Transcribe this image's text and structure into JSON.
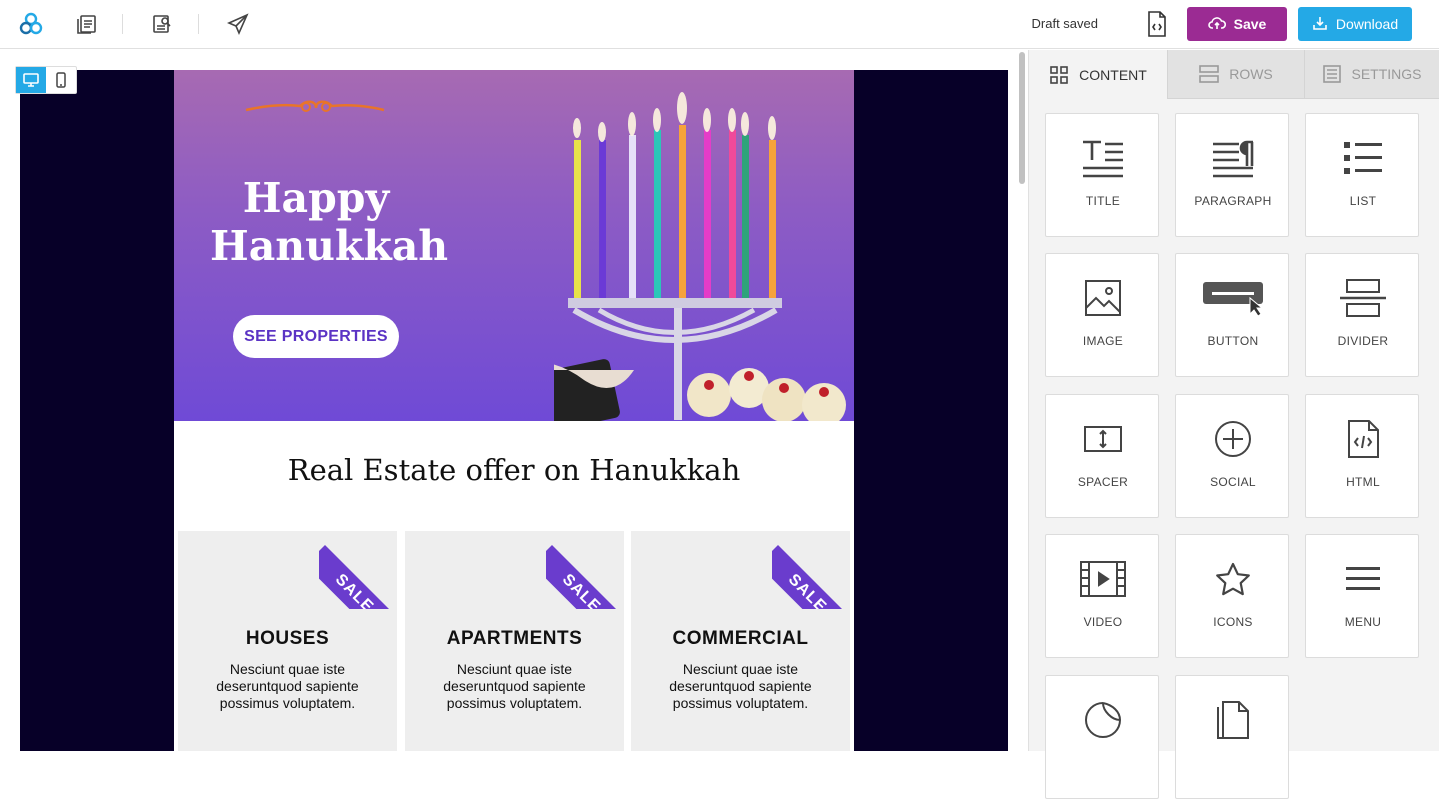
{
  "topbar": {
    "draft_status": "Draft saved",
    "save_label": "Save",
    "download_label": "Download"
  },
  "colors": {
    "save": "#9b2b93",
    "download": "#24a9e6",
    "stage_bg": "#070028",
    "accent_purple": "#6a3ccd"
  },
  "email": {
    "hero_title_line1": "Happy",
    "hero_title_line2": "Hanukkah",
    "hero_button": "SEE PROPERTIES",
    "heading": "Real Estate offer on Hanukkah",
    "cards": [
      {
        "badge": "SALE",
        "title": "HOUSES",
        "text": "Nesciunt quae iste deseruntquod sapiente possimus voluptatem."
      },
      {
        "badge": "SALE",
        "title": "APARTMENTS",
        "text": "Nesciunt quae iste deseruntquod sapiente possimus voluptatem."
      },
      {
        "badge": "SALE",
        "title": "COMMERCIAL",
        "text": "Nesciunt quae iste deseruntquod sapiente possimus voluptatem."
      }
    ]
  },
  "panel": {
    "tabs": [
      {
        "label": "CONTENT",
        "icon": "grid-icon"
      },
      {
        "label": "ROWS",
        "icon": "rows-icon"
      },
      {
        "label": "SETTINGS",
        "icon": "settings-icon"
      }
    ],
    "tiles": [
      {
        "label": "TITLE",
        "icon": "title-icon"
      },
      {
        "label": "PARAGRAPH",
        "icon": "paragraph-icon"
      },
      {
        "label": "LIST",
        "icon": "list-icon"
      },
      {
        "label": "IMAGE",
        "icon": "image-icon"
      },
      {
        "label": "BUTTON",
        "icon": "button-icon"
      },
      {
        "label": "DIVIDER",
        "icon": "divider-icon"
      },
      {
        "label": "SPACER",
        "icon": "spacer-icon"
      },
      {
        "label": "SOCIAL",
        "icon": "social-icon"
      },
      {
        "label": "HTML",
        "icon": "html-icon"
      },
      {
        "label": "VIDEO",
        "icon": "video-icon"
      },
      {
        "label": "ICONS",
        "icon": "star-icon"
      },
      {
        "label": "MENU",
        "icon": "menu-icon"
      },
      {
        "label": "",
        "icon": "sticker-icon"
      },
      {
        "label": "",
        "icon": "file-icon"
      }
    ]
  }
}
